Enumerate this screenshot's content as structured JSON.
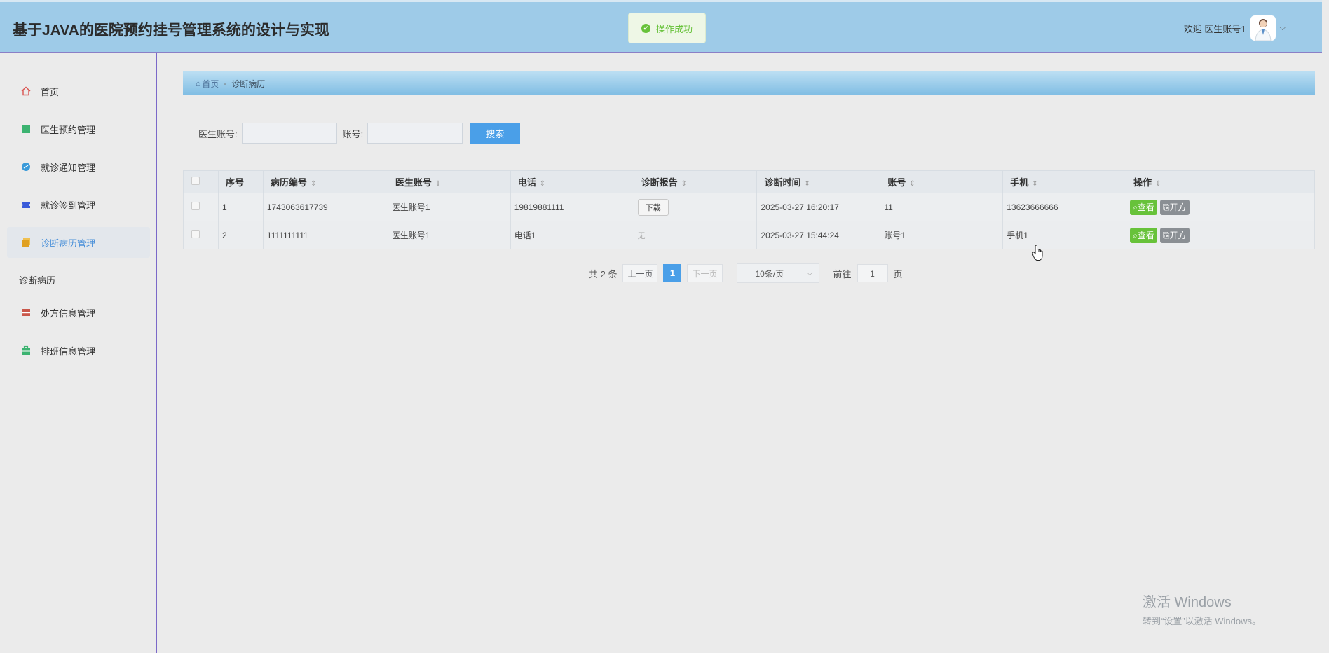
{
  "header": {
    "title": "基于JAVA的医院预约挂号管理系统的设计与实现",
    "toast": "操作成功",
    "welcome": "欢迎 医生账号1"
  },
  "sidebar": {
    "items": [
      {
        "label": "首页",
        "icon": "home-icon",
        "color": "#d9534f"
      },
      {
        "label": "医生预约管理",
        "icon": "square-icon",
        "color": "#3cb371"
      },
      {
        "label": "就诊通知管理",
        "icon": "circle-icon",
        "color": "#3a9ad9"
      },
      {
        "label": "就诊签到管理",
        "icon": "ticket-icon",
        "color": "#3a5bd9"
      },
      {
        "label": "诊断病历管理",
        "icon": "folder-icon",
        "color": "#e0a020"
      },
      {
        "label": "处方信息管理",
        "icon": "panel-icon",
        "color": "#c9574a"
      },
      {
        "label": "排班信息管理",
        "icon": "briefcase-icon",
        "color": "#3cb371"
      }
    ],
    "section_label": "诊断病历"
  },
  "breadcrumb": {
    "home": "首页",
    "current": "诊断病历"
  },
  "search": {
    "doctor_label": "医生账号:",
    "account_label": "账号:",
    "button": "搜索"
  },
  "table": {
    "headers": [
      "序号",
      "病历编号",
      "医生账号",
      "电话",
      "诊断报告",
      "诊断时间",
      "账号",
      "手机",
      "操作"
    ],
    "rows": [
      {
        "index": "1",
        "record_no": "1743063617739",
        "doctor": "医生账号1",
        "phone": "19819881111",
        "report": "下载",
        "time": "2025-03-27 16:20:17",
        "account": "11",
        "mobile": "13623666666"
      },
      {
        "index": "2",
        "record_no": "1111111111",
        "doctor": "医生账号1",
        "phone": "电话1",
        "report": "无",
        "time": "2025-03-27 15:44:24",
        "account": "账号1",
        "mobile": "手机1"
      }
    ],
    "view_label": "查看",
    "rx_label": "开方"
  },
  "pagination": {
    "total": "共 2 条",
    "prev": "上一页",
    "current": "1",
    "next": "下一页",
    "page_size": "10条/页",
    "goto_label": "前往",
    "goto_value": "1",
    "page_suffix": "页"
  },
  "watermark": {
    "line1": "激活 Windows",
    "line2": "转到“设置”以激活 Windows。"
  }
}
